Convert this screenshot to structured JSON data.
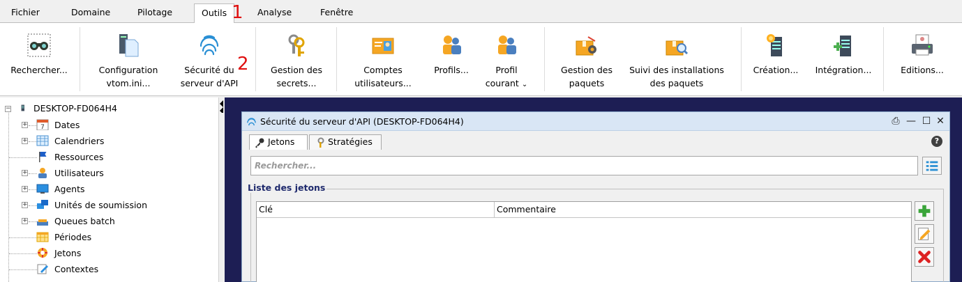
{
  "menu": {
    "items": [
      "Fichier",
      "Domaine",
      "Pilotage",
      "Outils",
      "Analyse",
      "Fenêtre"
    ],
    "active": "Outils"
  },
  "annotations": {
    "a1": "1",
    "a2": "2"
  },
  "ribbon": {
    "rechercher": "Rechercher...",
    "configuration_1": "Configuration",
    "configuration_2": "vtom.ini...",
    "securite_1": "Sécurité du",
    "securite_2": "serveur d'API",
    "secrets_1": "Gestion des",
    "secrets_2": "secrets...",
    "comptes_1": "Comptes",
    "comptes_2": "utilisateurs...",
    "profils": "Profils...",
    "profil_courant_1": "Profil",
    "profil_courant_2": "courant",
    "paquets_1": "Gestion des",
    "paquets_2": "paquets",
    "suivi_1": "Suivi des installations",
    "suivi_2": "des paquets",
    "creation": "Création...",
    "integration": "Intégration...",
    "editions": "Editions..."
  },
  "tree": {
    "root": "DESKTOP-FD064H4",
    "items": [
      "Dates",
      "Calendriers",
      "Ressources",
      "Utilisateurs",
      "Agents",
      "Unités de soumission",
      "Queues batch",
      "Périodes",
      "Jetons",
      "Contextes"
    ]
  },
  "dialog": {
    "title": "Sécurité du serveur d'API (DESKTOP-FD064H4)",
    "tab_jetons": "Jetons",
    "tab_strategies": "Stratégies",
    "help": "?",
    "search_placeholder": "Rechercher...",
    "group_label": "Liste des jetons",
    "col_cle": "Clé",
    "col_commentaire": "Commentaire"
  },
  "colors": {
    "accent": "#e01010",
    "workspace": "#1d1e54",
    "title_bar": "#d9e6f5",
    "group_label": "#1f2a6d"
  }
}
